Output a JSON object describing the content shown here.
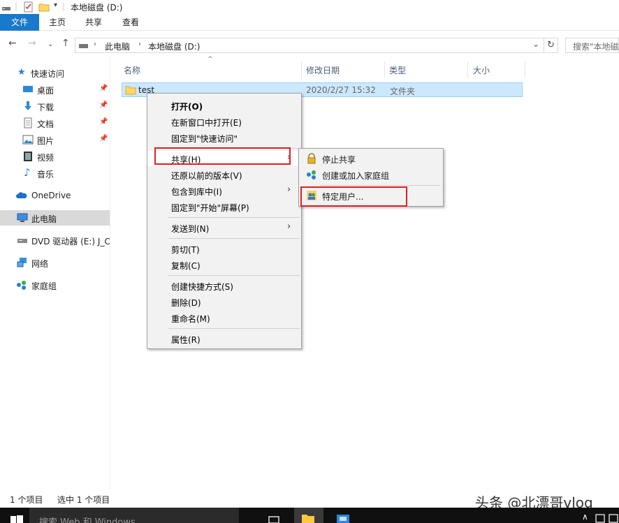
{
  "window": {
    "title": "本地磁盘 (D:)"
  },
  "ribbon": {
    "tabs": [
      "文件",
      "主页",
      "共享",
      "查看"
    ]
  },
  "address": {
    "segments": [
      "此电脑",
      "本地磁盘 (D:)"
    ],
    "search_placeholder": "搜索\"本地磁"
  },
  "nav": {
    "items": [
      {
        "label": "快速访问",
        "icon": "star-icon"
      },
      {
        "label": "桌面",
        "icon": "desktop-icon",
        "pinned": true
      },
      {
        "label": "下载",
        "icon": "download-icon",
        "pinned": true
      },
      {
        "label": "文档",
        "icon": "document-icon",
        "pinned": true
      },
      {
        "label": "图片",
        "icon": "picture-icon",
        "pinned": true
      },
      {
        "label": "视频",
        "icon": "video-icon"
      },
      {
        "label": "音乐",
        "icon": "music-icon"
      },
      {
        "label": "OneDrive",
        "icon": "cloud-icon"
      },
      {
        "label": "此电脑",
        "icon": "computer-icon",
        "selected": true
      },
      {
        "label": "DVD 驱动器 (E:) J_C",
        "icon": "dvd-icon"
      },
      {
        "label": "网络",
        "icon": "network-icon"
      },
      {
        "label": "家庭组",
        "icon": "homegroup-icon"
      }
    ]
  },
  "columns": [
    "名称",
    "修改日期",
    "类型",
    "大小"
  ],
  "files": [
    {
      "name": "test",
      "modified": "2020/2/27 15:32",
      "type": "文件夹",
      "size": ""
    }
  ],
  "context_menu": {
    "items": [
      "打开(O)",
      "在新窗口中打开(E)",
      "固定到\"快速访问\"",
      "共享(H)",
      "还原以前的版本(V)",
      "包含到库中(I)",
      "固定到\"开始\"屏幕(P)",
      "发送到(N)",
      "剪切(T)",
      "复制(C)",
      "创建快捷方式(S)",
      "删除(D)",
      "重命名(M)",
      "属性(R)"
    ]
  },
  "share_submenu": {
    "items": [
      "停止共享",
      "创建或加入家庭组",
      "特定用户..."
    ]
  },
  "status": {
    "item_count": "1 个项目",
    "selected": "选中 1 个项目"
  },
  "taskbar": {
    "search_placeholder": "搜索 Web 和 Windows"
  },
  "watermark": "头条 @北漂哥vlog",
  "colors": {
    "accent": "#1979ca",
    "selection": "#cce8ff",
    "highlight_box": "#e0201f"
  }
}
